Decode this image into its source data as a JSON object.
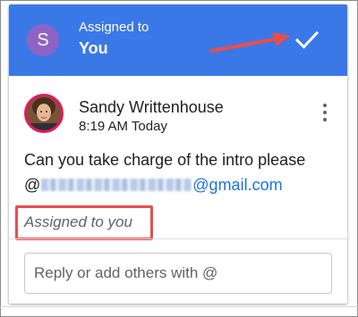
{
  "header": {
    "avatar_initial": "S",
    "assigned_label": "Assigned to",
    "assigned_value": "You",
    "confirm_icon": "check-icon",
    "header_color": "#3b78e7",
    "avatar_color": "#8e63c6"
  },
  "comment": {
    "author": "Sandy Writtenhouse",
    "timestamp": "8:19 AM Today",
    "message": "Can you take charge of the intro please",
    "mention_prefix": "@",
    "mention_domain": "@gmail.com",
    "assignment_note": "Assigned to you",
    "menu_icon": "more-vert-icon"
  },
  "reply": {
    "placeholder": "Reply or add others with @",
    "value": ""
  },
  "annotations": {
    "arrow_color": "#e94e4e",
    "highlight_color": "#e94e4e"
  }
}
